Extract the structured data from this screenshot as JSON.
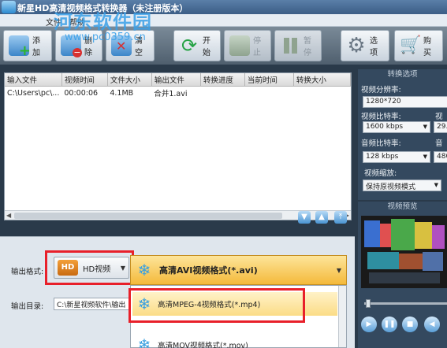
{
  "window": {
    "title": "新星HD高清视频格式转换器（未注册版本）"
  },
  "watermark": {
    "text": "河东软件园",
    "url": "www.pc0359.cn"
  },
  "menu": {
    "items": [
      "文件",
      "帮助"
    ]
  },
  "toolbar": {
    "add_label": "添加",
    "delete_label": "删除",
    "clear_label": "清空",
    "start_label": "开始",
    "stop_label": "停止",
    "pause_label": "暂停",
    "options_label": "选项",
    "buy_label": "购买"
  },
  "table": {
    "headers": [
      "输入文件",
      "视频时间",
      "文件大小",
      "输出文件",
      "转换进度",
      "当前时间",
      "转换大小"
    ],
    "rows": [
      [
        "C:\\Users\\pc\\...",
        "00:00:06",
        "4.1MB",
        "合并1.avi",
        "",
        "",
        ""
      ]
    ]
  },
  "settings": {
    "title": "转换选项",
    "resolution_label": "视频分辨率:",
    "resolution_value": "1280*720",
    "video_bitrate_label": "视频比特率:",
    "video_bitrate_value": "1600 kbps",
    "framerate_label": "视",
    "framerate_value": "29.",
    "audio_bitrate_label": "音频比特率:",
    "audio_bitrate_value": "128 kbps",
    "samplerate_label": "音",
    "samplerate_value": "480",
    "scale_label": "视频缩放:",
    "scale_value": "保持原视频模式"
  },
  "preview": {
    "title": "视频预览"
  },
  "output": {
    "format_label": "输出格式:",
    "category_value": "HD视频",
    "category_badge": "HD",
    "format_value": "高清AVI视频格式(*.avi)",
    "dir_label": "输出目录:",
    "dir_value": "C:\\新星视频软件\\输出"
  },
  "dropdown": {
    "items": [
      "高清MPEG-4视频格式(*.mp4)",
      "高清MOV视频格式(*.mov)"
    ]
  },
  "colors": {
    "highlight_box": "#e8202a",
    "format_bg": "#f4b93a",
    "panel_bg": "#34495f"
  }
}
